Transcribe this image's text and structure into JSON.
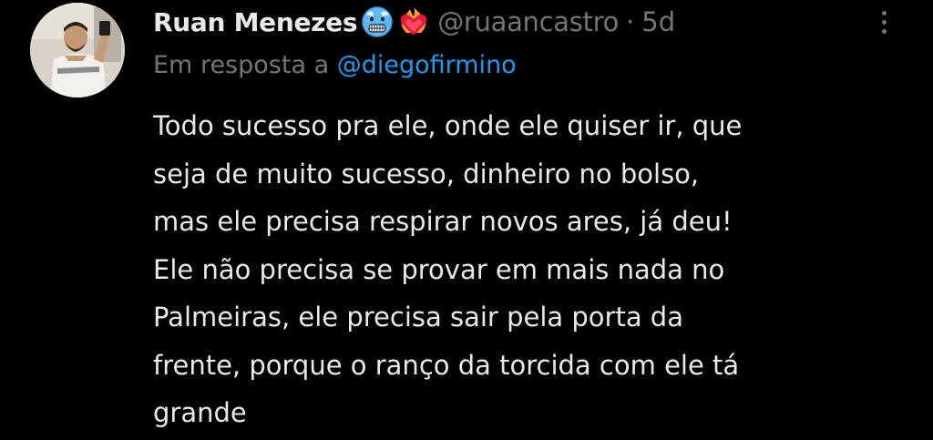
{
  "author": {
    "display_name": "Ruan Menezes",
    "emojis": [
      "cold-face-emoji",
      "heart-on-fire-emoji"
    ],
    "handle": "@ruaancastro",
    "separator": "·",
    "time": "5d",
    "avatar": "avatar"
  },
  "reply": {
    "prefix": "Em resposta a",
    "handle": "@diegofirmino"
  },
  "text_lines": [
    "Todo sucesso pra ele, onde ele quiser ir, que",
    "seja de muito sucesso, dinheiro no bolso,",
    "mas ele precisa respirar novos ares, já deu!",
    "Ele não precisa se provar em mais nada no",
    "Palmeiras, ele precisa sair pela porta da",
    "frente, porque o ranço da torcida com ele tá",
    "grande"
  ],
  "icons": {
    "more": "more-vertical-icon"
  },
  "colors": {
    "background": "#000000",
    "text": "#e7e9ea",
    "secondary": "#71767b",
    "link": "#1d9bf0"
  }
}
